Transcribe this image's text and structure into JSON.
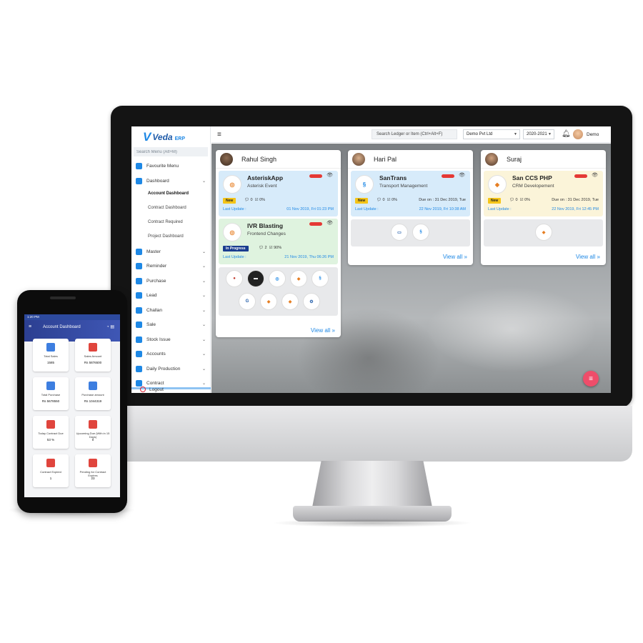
{
  "monitor": {
    "brand": {
      "mark": "V",
      "name": "Veda",
      "suffix": "ERP"
    },
    "menu_search_placeholder": "Search Menu (Alt+M)",
    "menu": [
      {
        "label": "Favourite Menu"
      },
      {
        "label": "Dashboard"
      },
      {
        "label": "Master"
      },
      {
        "label": "Reminder"
      },
      {
        "label": "Purchase"
      },
      {
        "label": "Lead"
      },
      {
        "label": "Challan"
      },
      {
        "label": "Sale"
      },
      {
        "label": "Stock Issue"
      },
      {
        "label": "Accounts"
      },
      {
        "label": "Daily Production"
      },
      {
        "label": "Contract"
      }
    ],
    "dashboard_submenu": [
      "Account Dashboard",
      "Contract Dashboard",
      "Contract Required",
      "Project Dashboard"
    ],
    "logout_label": "Logout",
    "topbar": {
      "ledger_search": "Search Ledger or Item (Ctrl+Alt+F)",
      "company": "Demo Pvt Ltd",
      "year": "2020-2021",
      "user": "Demo"
    },
    "columns": [
      {
        "name": "Rahul Singh",
        "cards": [
          {
            "title": "AsteriskApp",
            "subtitle": "Asterisk Event",
            "badge": "New",
            "comments": "0",
            "progress": "0%",
            "due": "",
            "last_update_label": "Last Update :",
            "last_update": "01 Nov 2019, Fri 01:23 PM"
          },
          {
            "title": "IVR Blasting",
            "subtitle": "Frontend Changes",
            "badge": "In Progress",
            "comments": "2",
            "progress": "90%",
            "due": "",
            "last_update_label": "Last Update :",
            "last_update": "21 Nov 2019, Thu 06:26 PM"
          }
        ],
        "view_all": "View all »"
      },
      {
        "name": "Hari Pal",
        "cards": [
          {
            "title": "SanTrans",
            "subtitle": "Transport Management",
            "badge": "New",
            "comments": "0",
            "progress": "0%",
            "due": "Due on : 31 Dec 2019, Tue",
            "last_update_label": "Last Update :",
            "last_update": "22 Nov 2019, Fri 10:38 AM"
          }
        ],
        "view_all": "View all »"
      },
      {
        "name": "Suraj",
        "cards": [
          {
            "title": "San CCS PHP",
            "subtitle": "CRM Developement",
            "badge": "New",
            "comments": "0",
            "progress": "0%",
            "due": "Due on : 31 Dec 2019, Tue",
            "last_update_label": "Last Update :",
            "last_update": "22 Nov 2019, Fri 12:45 PM"
          }
        ],
        "view_all": "View all »"
      }
    ],
    "icons": {
      "hamburger": "hamburger-icon",
      "bell": "bell-icon",
      "eye": "eye-icon",
      "fab": "menu-fab-icon"
    },
    "colors": {
      "accent": "#1e88e5",
      "flag": "#e53935",
      "fab": "#ef4d6a",
      "badge_new": "#f5c518",
      "badge_progress": "#1a3d8f"
    }
  },
  "phone": {
    "status_time": "1:20 PM",
    "title": "Account Dashboard",
    "tiles": [
      {
        "label": "Total Sales",
        "value": "1585"
      },
      {
        "label": "Sales Amount",
        "value": "Rs 5876500"
      },
      {
        "label": "Total Purchase",
        "value": "Rs 5678550"
      },
      {
        "label": "Purchase amount",
        "value": "Rs 1044319"
      },
      {
        "label": "Today Contract Due",
        "value": "53 %"
      },
      {
        "label": "Upcoming Due (With in 15 Days)",
        "value": "0"
      },
      {
        "label": "Contract Expired",
        "value": "1"
      },
      {
        "label": "Pending for Contract Expires",
        "value": "23"
      }
    ]
  }
}
